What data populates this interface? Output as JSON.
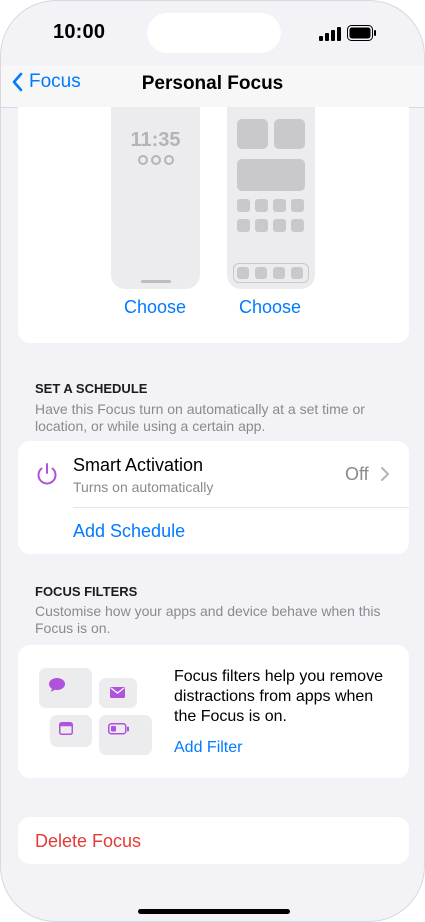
{
  "status": {
    "time": "10:00"
  },
  "nav": {
    "back_label": "Focus",
    "title": "Personal Focus"
  },
  "preview": {
    "lock_time": "11:35",
    "choose_lock": "Choose",
    "choose_home": "Choose"
  },
  "schedule": {
    "header": "SET A SCHEDULE",
    "description": "Have this Focus turn on automatically at a set time or location, or while using a certain app.",
    "smart_title": "Smart Activation",
    "smart_sub": "Turns on automatically",
    "smart_value": "Off",
    "add_label": "Add Schedule"
  },
  "filters": {
    "header": "FOCUS FILTERS",
    "description": "Customise how your apps and device behave when this Focus is on.",
    "body": "Focus filters help you remove distractions from apps when the Focus is on.",
    "add_label": "Add Filter"
  },
  "delete_label": "Delete Focus",
  "colors": {
    "accent": "#007aff",
    "purple": "#af52de",
    "destructive": "#ff3b30"
  }
}
